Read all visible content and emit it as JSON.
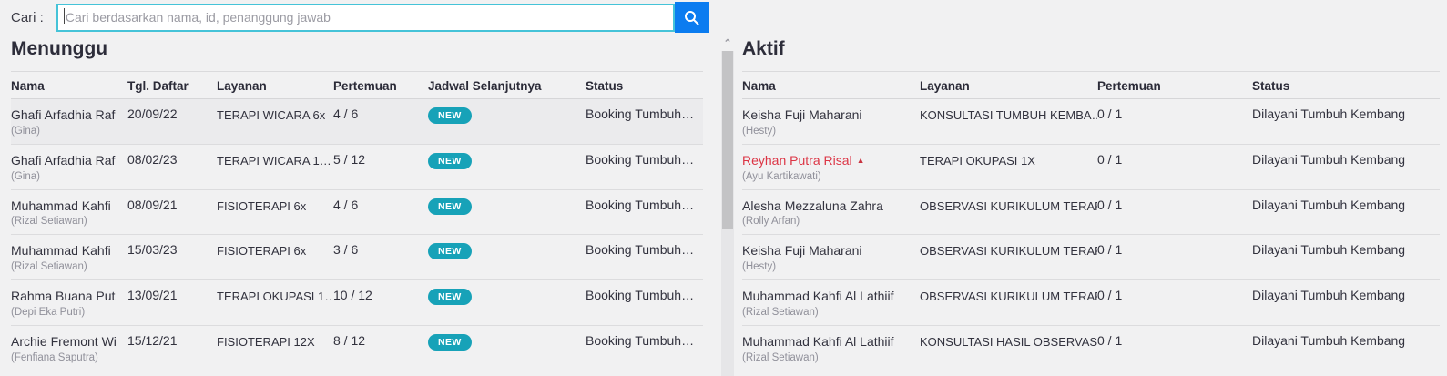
{
  "search": {
    "label": "Cari :",
    "placeholder": "Cari berdasarkan nama, id, penanggung jawab",
    "value": ""
  },
  "icons": {
    "scroll_up_glyph": "⌃",
    "warning_glyph": "▲"
  },
  "colors": {
    "primary_blue": "#0b7cf0",
    "input_border": "#45c3d8",
    "badge_teal": "#17a2b8",
    "danger_red": "#dc3545"
  },
  "waiting_panel": {
    "title": "Menunggu",
    "columns": [
      "Nama",
      "Tgl. Daftar",
      "Layanan",
      "Pertemuan",
      "Jadwal Selanjutnya",
      "Status"
    ],
    "rows": [
      {
        "name": "Ghafi Arfadhia Raf",
        "caregiver": "(Gina)",
        "date": "20/09/22",
        "service": "TERAPI WICARA 6x",
        "meetings": "4 / 6",
        "schedule_badge": "NEW",
        "status": "Booking Tumbuh…",
        "highlighted": true
      },
      {
        "name": "Ghafi Arfadhia Raf",
        "caregiver": "(Gina)",
        "date": "08/02/23",
        "service": "TERAPI WICARA 1…",
        "meetings": "5 / 12",
        "schedule_badge": "NEW",
        "status": "Booking Tumbuh…",
        "highlighted": false
      },
      {
        "name": "Muhammad Kahfi",
        "caregiver": "(Rizal Setiawan)",
        "date": "08/09/21",
        "service": "FISIOTERAPI 6x",
        "meetings": "4 / 6",
        "schedule_badge": "NEW",
        "status": "Booking Tumbuh…",
        "highlighted": false
      },
      {
        "name": "Muhammad Kahfi",
        "caregiver": "(Rizal Setiawan)",
        "date": "15/03/23",
        "service": "FISIOTERAPI 6x",
        "meetings": "3 / 6",
        "schedule_badge": "NEW",
        "status": "Booking Tumbuh…",
        "highlighted": false
      },
      {
        "name": "Rahma Buana Put",
        "caregiver": "(Depi Eka Putri)",
        "date": "13/09/21",
        "service": "TERAPI OKUPASI 1…",
        "meetings": "10 / 12",
        "schedule_badge": "NEW",
        "status": "Booking Tumbuh…",
        "highlighted": false
      },
      {
        "name": "Archie Fremont Wi",
        "caregiver": "(Fenfiana Saputra)",
        "date": "15/12/21",
        "service": "FISIOTERAPI 12X",
        "meetings": "8 / 12",
        "schedule_badge": "NEW",
        "status": "Booking Tumbuh…",
        "highlighted": false
      }
    ]
  },
  "active_panel": {
    "title": "Aktif",
    "columns": [
      "Nama",
      "Layanan",
      "Pertemuan",
      "Status"
    ],
    "rows": [
      {
        "name": "Keisha Fuji Maharani",
        "caregiver": "(Hesty)",
        "service": "KONSULTASI TUMBUH KEMBA…",
        "meetings": "0 / 1",
        "status": "Dilayani Tumbuh Kembang",
        "alert": false
      },
      {
        "name": "Reyhan Putra Risal",
        "caregiver": "(Ayu Kartikawati)",
        "service": "TERAPI OKUPASI 1X",
        "meetings": "0 / 1",
        "status": "Dilayani Tumbuh Kembang",
        "alert": true
      },
      {
        "name": "Alesha Mezzaluna Zahra",
        "caregiver": "(Rolly Arfan)",
        "service": "OBSERVASI KURIKULUM TERAPI",
        "meetings": "0 / 1",
        "status": "Dilayani Tumbuh Kembang",
        "alert": false
      },
      {
        "name": "Keisha Fuji Maharani",
        "caregiver": "(Hesty)",
        "service": "OBSERVASI KURIKULUM TERAPI",
        "meetings": "0 / 1",
        "status": "Dilayani Tumbuh Kembang",
        "alert": false
      },
      {
        "name": "Muhammad Kahfi Al Lathiif",
        "caregiver": "(Rizal Setiawan)",
        "service": "OBSERVASI KURIKULUM TERAPI",
        "meetings": "0 / 1",
        "status": "Dilayani Tumbuh Kembang",
        "alert": false
      },
      {
        "name": "Muhammad Kahfi Al Lathiif",
        "caregiver": "(Rizal Setiawan)",
        "service": "KONSULTASI HASIL OBSERVASI",
        "meetings": "0 / 1",
        "status": "Dilayani Tumbuh Kembang",
        "alert": false
      }
    ]
  }
}
